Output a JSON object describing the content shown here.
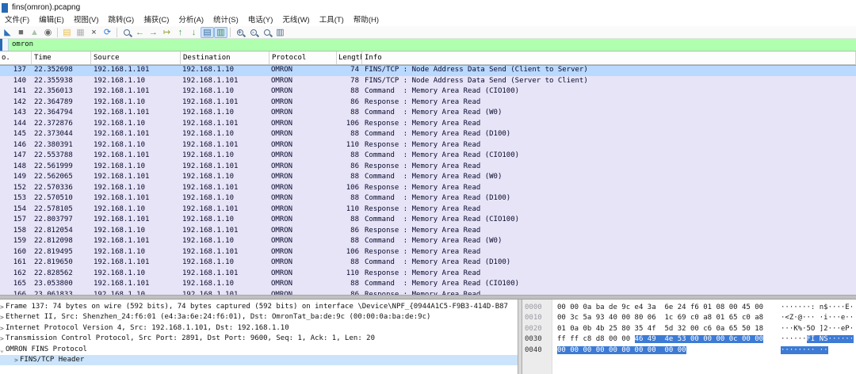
{
  "window": {
    "title": "fins(omron).pcapng"
  },
  "menu": {
    "items": [
      "文件(F)",
      "编辑(E)",
      "视图(V)",
      "跳转(G)",
      "捕获(C)",
      "分析(A)",
      "统计(S)",
      "电话(Y)",
      "无线(W)",
      "工具(T)",
      "帮助(H)"
    ]
  },
  "toolbar": {
    "icons": [
      {
        "type": "glyph",
        "name": "start-capture-icon",
        "glyph": "◣",
        "color": "#2e71b8"
      },
      {
        "type": "glyph",
        "name": "stop-capture-icon",
        "glyph": "■",
        "color": "#6b6b6b"
      },
      {
        "type": "glyph",
        "name": "restart-capture-icon",
        "glyph": "▲",
        "color": "#a8c4a8"
      },
      {
        "type": "glyph",
        "name": "capture-options-icon",
        "glyph": "◉",
        "color": "#6b6b6b"
      },
      {
        "type": "sep"
      },
      {
        "type": "glyph",
        "name": "open-file-icon",
        "glyph": "▤",
        "color": "#e9bd4a"
      },
      {
        "type": "glyph",
        "name": "save-file-icon",
        "glyph": "▦",
        "color": "#b0b0b0"
      },
      {
        "type": "glyph",
        "name": "close-file-icon",
        "glyph": "×",
        "color": "#3a3a3a"
      },
      {
        "type": "glyph",
        "name": "reload-icon",
        "glyph": "⟳",
        "color": "#2d7dd2"
      },
      {
        "type": "sep"
      },
      {
        "type": "mag",
        "name": "find-packet-icon",
        "sym": ""
      },
      {
        "type": "glyph",
        "name": "go-back-icon",
        "glyph": "←",
        "color": "#43a047"
      },
      {
        "type": "glyph",
        "name": "go-forward-icon",
        "glyph": "→",
        "color": "#43a047"
      },
      {
        "type": "glyph",
        "name": "go-to-packet-icon",
        "glyph": "↦",
        "color": "#9aa23a"
      },
      {
        "type": "glyph",
        "name": "go-first-icon",
        "glyph": "↑",
        "color": "#43a047"
      },
      {
        "type": "glyph",
        "name": "go-last-icon",
        "glyph": "↓",
        "color": "#43a047"
      },
      {
        "type": "glyph",
        "name": "auto-scroll-icon",
        "glyph": "▤",
        "color": "#3a6ea5",
        "pressed": true
      },
      {
        "type": "glyph",
        "name": "colorize-icon",
        "glyph": "▥",
        "color": "#3a8a5a",
        "pressed": true
      },
      {
        "type": "sep"
      },
      {
        "type": "mag",
        "name": "zoom-in-icon",
        "sym": "+"
      },
      {
        "type": "mag",
        "name": "zoom-out-icon",
        "sym": "-"
      },
      {
        "type": "mag",
        "name": "zoom-reset-icon",
        "sym": ""
      },
      {
        "type": "glyph",
        "name": "resize-columns-icon",
        "glyph": "▥",
        "color": "#4a6a8a"
      }
    ]
  },
  "filter": {
    "value": "omron"
  },
  "packet_list": {
    "columns": [
      {
        "label": "o.",
        "cls": "c0"
      },
      {
        "label": "Time",
        "cls": "c1"
      },
      {
        "label": "Source",
        "cls": "c2"
      },
      {
        "label": "Destination",
        "cls": "c3"
      },
      {
        "label": "Protocol",
        "cls": "c4"
      },
      {
        "label": "Length",
        "cls": "c5"
      },
      {
        "label": "Info",
        "cls": "c6"
      }
    ],
    "rows": [
      {
        "no": "137",
        "time": "22.352698",
        "source": "192.168.1.101",
        "destination": "192.168.1.10",
        "protocol": "OMRON",
        "length": "74",
        "info": "FINS/TCP : Node Address Data Send (Client to Server)",
        "selected": true
      },
      {
        "no": "140",
        "time": "22.355938",
        "source": "192.168.1.10",
        "destination": "192.168.1.101",
        "protocol": "OMRON",
        "length": "78",
        "info": "FINS/TCP : Node Address Data Send (Server to Client)"
      },
      {
        "no": "141",
        "time": "22.356013",
        "source": "192.168.1.101",
        "destination": "192.168.1.10",
        "protocol": "OMRON",
        "length": "88",
        "info": "Command  : Memory Area Read (CIO100)"
      },
      {
        "no": "142",
        "time": "22.364789",
        "source": "192.168.1.10",
        "destination": "192.168.1.101",
        "protocol": "OMRON",
        "length": "86",
        "info": "Response : Memory Area Read"
      },
      {
        "no": "143",
        "time": "22.364794",
        "source": "192.168.1.101",
        "destination": "192.168.1.10",
        "protocol": "OMRON",
        "length": "88",
        "info": "Command  : Memory Area Read (W0)"
      },
      {
        "no": "144",
        "time": "22.372876",
        "source": "192.168.1.10",
        "destination": "192.168.1.101",
        "protocol": "OMRON",
        "length": "106",
        "info": "Response : Memory Area Read"
      },
      {
        "no": "145",
        "time": "22.373044",
        "source": "192.168.1.101",
        "destination": "192.168.1.10",
        "protocol": "OMRON",
        "length": "88",
        "info": "Command  : Memory Area Read (D100)"
      },
      {
        "no": "146",
        "time": "22.380391",
        "source": "192.168.1.10",
        "destination": "192.168.1.101",
        "protocol": "OMRON",
        "length": "110",
        "info": "Response : Memory Area Read"
      },
      {
        "no": "147",
        "time": "22.553788",
        "source": "192.168.1.101",
        "destination": "192.168.1.10",
        "protocol": "OMRON",
        "length": "88",
        "info": "Command  : Memory Area Read (CIO100)"
      },
      {
        "no": "148",
        "time": "22.561999",
        "source": "192.168.1.10",
        "destination": "192.168.1.101",
        "protocol": "OMRON",
        "length": "86",
        "info": "Response : Memory Area Read"
      },
      {
        "no": "149",
        "time": "22.562065",
        "source": "192.168.1.101",
        "destination": "192.168.1.10",
        "protocol": "OMRON",
        "length": "88",
        "info": "Command  : Memory Area Read (W0)"
      },
      {
        "no": "152",
        "time": "22.570336",
        "source": "192.168.1.10",
        "destination": "192.168.1.101",
        "protocol": "OMRON",
        "length": "106",
        "info": "Response : Memory Area Read"
      },
      {
        "no": "153",
        "time": "22.570510",
        "source": "192.168.1.101",
        "destination": "192.168.1.10",
        "protocol": "OMRON",
        "length": "88",
        "info": "Command  : Memory Area Read (D100)"
      },
      {
        "no": "154",
        "time": "22.578105",
        "source": "192.168.1.10",
        "destination": "192.168.1.101",
        "protocol": "OMRON",
        "length": "110",
        "info": "Response : Memory Area Read"
      },
      {
        "no": "157",
        "time": "22.803797",
        "source": "192.168.1.101",
        "destination": "192.168.1.10",
        "protocol": "OMRON",
        "length": "88",
        "info": "Command  : Memory Area Read (CIO100)"
      },
      {
        "no": "158",
        "time": "22.812054",
        "source": "192.168.1.10",
        "destination": "192.168.1.101",
        "protocol": "OMRON",
        "length": "86",
        "info": "Response : Memory Area Read"
      },
      {
        "no": "159",
        "time": "22.812098",
        "source": "192.168.1.101",
        "destination": "192.168.1.10",
        "protocol": "OMRON",
        "length": "88",
        "info": "Command  : Memory Area Read (W0)"
      },
      {
        "no": "160",
        "time": "22.819495",
        "source": "192.168.1.10",
        "destination": "192.168.1.101",
        "protocol": "OMRON",
        "length": "106",
        "info": "Response : Memory Area Read"
      },
      {
        "no": "161",
        "time": "22.819650",
        "source": "192.168.1.101",
        "destination": "192.168.1.10",
        "protocol": "OMRON",
        "length": "88",
        "info": "Command  : Memory Area Read (D100)"
      },
      {
        "no": "162",
        "time": "22.828562",
        "source": "192.168.1.10",
        "destination": "192.168.1.101",
        "protocol": "OMRON",
        "length": "110",
        "info": "Response : Memory Area Read"
      },
      {
        "no": "165",
        "time": "23.053800",
        "source": "192.168.1.101",
        "destination": "192.168.1.10",
        "protocol": "OMRON",
        "length": "88",
        "info": "Command  : Memory Area Read (CIO100)"
      },
      {
        "no": "166",
        "time": "23.061833",
        "source": "192.168.1.10",
        "destination": "192.168.1.101",
        "protocol": "OMRON",
        "length": "86",
        "info": "Response : Memory Area Read"
      }
    ]
  },
  "details": {
    "lines": [
      {
        "expander": ">",
        "indent": 0,
        "text": "Frame 137: 74 bytes on wire (592 bits), 74 bytes captured (592 bits) on interface \\Device\\NPF_{0944A1C5-F9B3-414D-B87"
      },
      {
        "expander": ">",
        "indent": 0,
        "text": "Ethernet II, Src: Shenzhen_24:f6:01 (e4:3a:6e:24:f6:01), Dst: OmronTat_ba:de:9c (00:00:0a:ba:de:9c)"
      },
      {
        "expander": ">",
        "indent": 0,
        "text": "Internet Protocol Version 4, Src: 192.168.1.101, Dst: 192.168.1.10"
      },
      {
        "expander": ">",
        "indent": 0,
        "text": "Transmission Control Protocol, Src Port: 2891, Dst Port: 9600, Seq: 1, Ack: 1, Len: 20"
      },
      {
        "expander": "⌄",
        "indent": 0,
        "text": "OMRON FINS Protocol"
      },
      {
        "expander": ">",
        "indent": 1,
        "text": "FINS/TCP Header",
        "selected": true
      }
    ]
  },
  "hex": {
    "rows": [
      {
        "offset": "0000",
        "active": false,
        "hex_pre": "00 00 0a ba de 9c e4 3a  6e 24 f6 01 08 00 45 00",
        "hex_sel": "",
        "ascii_pre": "·······: n$····E·",
        "ascii_sel": ""
      },
      {
        "offset": "0010",
        "active": false,
        "hex_pre": "00 3c 5a 93 40 00 80 06  1c 69 c0 a8 01 65 c0 a8",
        "hex_sel": "",
        "ascii_pre": "·<Z·@··· ·i···e··",
        "ascii_sel": ""
      },
      {
        "offset": "0020",
        "active": false,
        "hex_pre": "01 0a 0b 4b 25 80 35 4f  5d 32 00 c6 0a 65 50 18",
        "hex_sel": "",
        "ascii_pre": "···K%·5O ]2···eP·",
        "ascii_sel": ""
      },
      {
        "offset": "0030",
        "active": true,
        "hex_pre": "ff ff c8 d8 00 00 ",
        "hex_sel": "46 49  4e 53 00 00 00 0c 00 00",
        "ascii_pre": "······",
        "ascii_sel": "FI NS······"
      },
      {
        "offset": "0040",
        "active": true,
        "hex_pre": "",
        "hex_sel": "00 00 00 00 00 00 00 00  00 00",
        "ascii_pre": "",
        "ascii_sel": "········ ··"
      }
    ]
  },
  "colors": {
    "row_bg": "#e6e4f6",
    "selected_row_bg": "#b9d9ff",
    "filter_valid_bg": "#afffaf",
    "hex_selection_bg": "#3d7bd5",
    "detail_selected_bg": "#cbe4fb"
  }
}
